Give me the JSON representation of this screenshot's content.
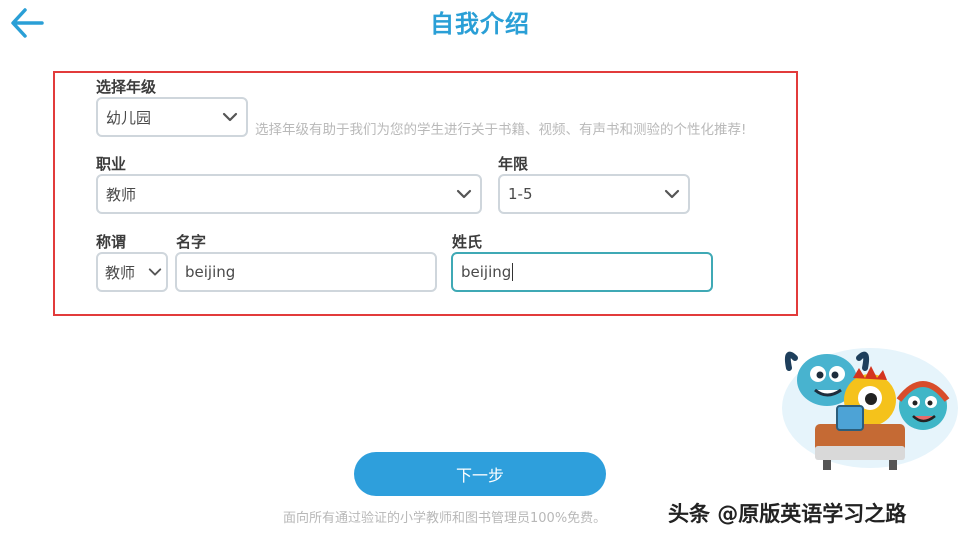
{
  "header": {
    "title": "自我介绍",
    "back_icon": "arrow-left-icon"
  },
  "form": {
    "grade": {
      "label": "选择年级",
      "value": "幼儿园",
      "hint": "选择年级有助于我们为您的学生进行关于书籍、视频、有声书和测验的个性化推荐!"
    },
    "occupation": {
      "label": "职业",
      "value": "教师"
    },
    "years": {
      "label": "年限",
      "value": "1-5"
    },
    "title": {
      "label": "称谓",
      "value": "教师"
    },
    "first_name": {
      "label": "名字",
      "value": "beijing"
    },
    "last_name": {
      "label": "姓氏",
      "value": "beijing"
    }
  },
  "next_button": {
    "label": "下一步"
  },
  "footer": {
    "note": "面向所有通过验证的小学教师和图书管理员100%免费。"
  },
  "watermark": {
    "text": "头条 @原版英语学习之路"
  },
  "colors": {
    "accent": "#2e9fdc",
    "title": "#2a9fd6",
    "highlight_border": "#e23b3b",
    "focused_border": "#3fa9b5"
  }
}
